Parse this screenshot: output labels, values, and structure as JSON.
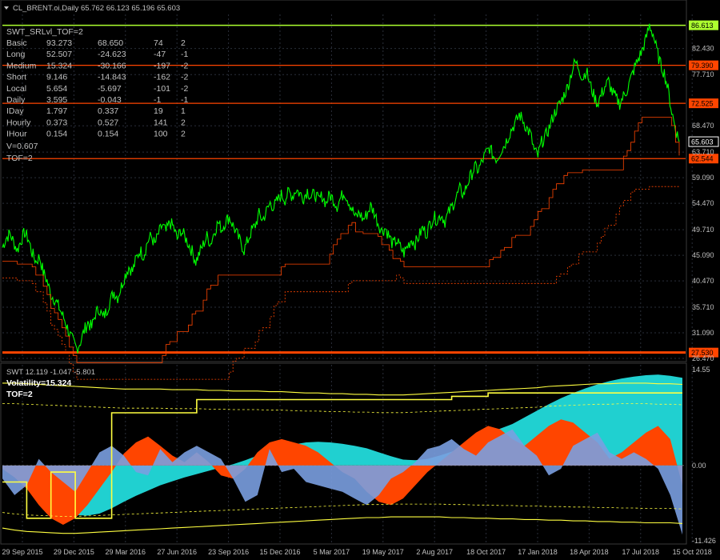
{
  "header": {
    "symbol_line": "CL_BRENT.oi,Daily  65.762 66.123 65.196 65.603"
  },
  "info_panel": {
    "title": "SWT_SRLvl_TOF=2",
    "rows": [
      {
        "name": "Basic",
        "a": "93.273",
        "b": "68.650",
        "c": "74",
        "d": "2"
      },
      {
        "name": "Long",
        "a": "52.507",
        "b": "-24.623",
        "c": "-47",
        "d": "-1"
      },
      {
        "name": "Medium",
        "a": "15.324",
        "b": "-30.166",
        "c": "-197",
        "d": "-2"
      },
      {
        "name": "Short",
        "a": "9.146",
        "b": "-14.843",
        "c": "-162",
        "d": "-2"
      },
      {
        "name": "Local",
        "a": "5.654",
        "b": "-5.697",
        "c": "-101",
        "d": "-2"
      },
      {
        "name": "Daily",
        "a": "3.595",
        "b": "-0.043",
        "c": "-1",
        "d": "-1"
      },
      {
        "name": "IDay",
        "a": "1.797",
        "b": "0.337",
        "c": "19",
        "d": "1"
      },
      {
        "name": "Hourly",
        "a": "0.373",
        "b": "0.527",
        "c": "141",
        "d": "2"
      },
      {
        "name": "IHour",
        "a": "0.154",
        "b": "0.154",
        "c": "100",
        "d": "2"
      }
    ],
    "v_line": "V=0.607",
    "tof_line": "TOF=2"
  },
  "lower_panel": {
    "title": "SWT 12.119 -1.047 -5.801",
    "volatility": "Volatility=15.324",
    "tof": "TOF=2"
  },
  "colors": {
    "background": "#000000",
    "price": "#00ff00",
    "level": "#ff4500",
    "level_thin": "#ff4500",
    "top_level": "#adff2f",
    "grid": "#2a2f3a",
    "text": "#c0c0c0",
    "cyan": "#20d0d0",
    "orange": "#ff4500",
    "blue": "#7a9ee0",
    "yellow": "#ffff40"
  },
  "chart_data": [
    {
      "type": "line",
      "title": "CL_BRENT.oi,Daily",
      "x_tick_labels": [
        "29 Sep 2015",
        "29 Dec 2015",
        "29 Mar 2016",
        "27 Jun 2016",
        "23 Sep 2016",
        "15 Dec 2016",
        "5 Mar 2017",
        "19 May 2017",
        "2 Aug 2017",
        "18 Oct 2017",
        "17 Jan 2018",
        "18 Apr 2018",
        "17 Jul 2018",
        "15 Oct 2018"
      ],
      "y_tick_labels": [
        "82.430",
        "77.710",
        "68.470",
        "63.710",
        "59.090",
        "54.470",
        "49.710",
        "45.090",
        "40.470",
        "35.710",
        "31.090",
        "26.470"
      ],
      "ylim": [
        26.47,
        88.0
      ],
      "price_labels": [
        {
          "value": 86.613,
          "label": "86.613",
          "color": "#adff2f"
        },
        {
          "value": 79.39,
          "label": "79.390",
          "color": "#ff4500"
        },
        {
          "value": 72.525,
          "label": "72.525",
          "color": "#ff4500"
        },
        {
          "value": 65.603,
          "label": "65.603",
          "color": "#ffffff"
        },
        {
          "value": 62.544,
          "label": "62.544",
          "color": "#ff4500"
        },
        {
          "value": 27.53,
          "label": "27.530",
          "color": "#ff4500"
        }
      ],
      "series": [
        {
          "values": [
            46.5,
            48.2,
            49.0,
            47.5,
            46.0,
            47.8,
            49.2,
            48.0,
            45.5,
            44.0,
            44.8,
            42.0,
            40.5,
            38.0,
            37.2,
            36.0,
            34.5,
            33.0,
            31.0,
            29.5,
            28.2,
            29.5,
            31.5,
            33.0,
            32.0,
            34.5,
            35.5,
            33.8,
            35.0,
            37.0,
            38.5,
            37.5,
            39.5,
            41.5,
            43.0,
            42.2,
            44.5,
            46.0,
            45.0,
            47.5,
            48.6,
            47.0,
            49.0,
            50.5,
            49.3,
            51.0,
            50.2,
            48.0,
            49.6,
            48.5,
            47.2,
            45.8,
            44.0,
            45.5,
            47.0,
            48.5,
            47.2,
            49.4,
            51.0,
            49.8,
            51.2,
            52.0,
            50.5,
            49.0,
            47.5,
            46.0,
            47.8,
            49.5,
            50.5,
            52.5,
            51.5,
            53.0,
            54.5,
            53.8,
            55.0,
            56.0,
            55.2,
            56.5,
            55.8,
            57.0,
            56.2,
            55.5,
            56.8,
            55.6,
            56.2,
            55.0,
            55.8,
            54.5,
            56.0,
            55.2,
            54.0,
            55.5,
            56.5,
            55.0,
            53.5,
            51.8,
            52.8,
            51.5,
            52.5,
            54.0,
            52.8,
            51.0,
            49.5,
            50.0,
            48.5,
            47.0,
            47.8,
            46.5,
            45.5,
            46.8,
            48.0,
            47.2,
            48.5,
            50.0,
            49.0,
            50.8,
            52.0,
            51.5,
            52.5,
            51.2,
            52.8,
            54.0,
            55.5,
            57.0,
            56.0,
            58.0,
            59.5,
            61.0,
            60.5,
            62.0,
            63.5,
            64.5,
            63.0,
            62.5,
            64.0,
            65.0,
            66.5,
            68.0,
            69.0,
            70.5,
            69.5,
            68.0,
            67.0,
            64.0,
            63.0,
            65.5,
            66.5,
            68.0,
            70.0,
            71.5,
            72.5,
            74.0,
            75.5,
            78.0,
            80.0,
            79.0,
            77.0,
            78.5,
            76.0,
            74.0,
            72.5,
            74.0,
            75.5,
            76.5,
            74.5,
            73.5,
            72.5,
            73.8,
            75.0,
            77.0,
            79.0,
            80.5,
            82.0,
            84.0,
            86.6,
            85.0,
            82.0,
            79.5,
            78.0,
            75.0,
            71.0,
            68.0,
            65.6
          ]
        }
      ]
    },
    {
      "type": "area",
      "title": "SWT 12.119 -1.047 -5.801",
      "y_tick_labels": [
        "14.55",
        "0.00",
        "-11.426"
      ],
      "ylim": [
        -11.426,
        14.55
      ],
      "series": [
        {
          "name": "cyan",
          "values": [
            -0.5,
            -1.2,
            -2.5,
            -4.0,
            -5.5,
            -6.8,
            -7.5,
            -7.6,
            -7.3,
            -6.5,
            -5.5,
            -4.6,
            -3.8,
            -3.0,
            -2.4,
            -1.8,
            -1.3,
            -0.8,
            -0.3,
            0.2,
            0.8,
            1.5,
            2.2,
            2.8,
            3.2,
            3.5,
            3.6,
            3.5,
            3.3,
            3.0,
            2.6,
            2.0,
            1.4,
            0.9,
            0.8,
            1.0,
            1.5,
            2.1,
            2.8,
            3.8,
            4.8,
            5.6,
            6.3,
            7.3,
            8.3,
            9.3,
            10.2,
            11.0,
            11.7,
            12.3,
            12.8,
            13.2,
            13.5,
            13.7,
            13.8,
            13.6,
            13.3
          ]
        },
        {
          "name": "orange",
          "values": [
            -0.5,
            -1.8,
            -3.5,
            -6.0,
            -8.0,
            -9.0,
            -8.0,
            -6.0,
            -3.5,
            -1.0,
            1.8,
            3.5,
            4.4,
            3.0,
            1.5,
            0.5,
            2.0,
            0.5,
            -1.5,
            -2.0,
            -0.5,
            2.0,
            3.5,
            4.0,
            3.5,
            3.0,
            2.0,
            0.5,
            -1.0,
            -2.0,
            -4.0,
            -5.5,
            -6.0,
            -5.0,
            -3.0,
            -1.0,
            0.5,
            2.0,
            3.5,
            5.0,
            6.0,
            5.5,
            4.0,
            3.0,
            4.5,
            6.0,
            7.0,
            6.5,
            5.0,
            3.5,
            1.0,
            2.0,
            3.5,
            5.0,
            6.0,
            4.0,
            -3.0
          ]
        },
        {
          "name": "blue",
          "values": [
            -2.0,
            -4.5,
            -3.0,
            1.0,
            -1.0,
            -2.5,
            -4.0,
            -1.0,
            2.0,
            3.0,
            1.5,
            -1.0,
            -1.5,
            2.5,
            0.5,
            2.0,
            3.0,
            2.0,
            1.0,
            -2.0,
            -5.5,
            -4.5,
            2.5,
            -1.0,
            -0.5,
            -2.5,
            -3.0,
            -3.5,
            -4.0,
            -5.0,
            -6.0,
            -4.5,
            -2.0,
            -1.0,
            0.5,
            2.5,
            3.0,
            4.0,
            2.5,
            1.5,
            3.5,
            4.5,
            5.5,
            3.0,
            1.5,
            -1.5,
            -0.5,
            3.0,
            4.0,
            5.0,
            2.0,
            1.0,
            2.0,
            1.0,
            -0.5,
            -4.5,
            -10.5
          ]
        },
        {
          "name": "yellow-step",
          "values": [
            -2.5,
            -2.5,
            -8.0,
            -8.0,
            -1.0,
            -1.0,
            -8.0,
            -8.0,
            -8.0,
            8.0,
            8.0,
            8.0,
            8.0,
            8.0,
            8.0,
            8.0,
            10.0,
            10.0,
            10.0,
            10.0,
            10.0,
            10.0,
            10.0,
            10.0,
            10.0,
            10.0,
            10.0,
            10.0,
            10.0,
            10.0,
            10.0,
            10.0,
            10.0,
            10.0,
            10.0,
            10.0,
            10.0,
            10.5,
            10.5,
            10.5,
            11.0,
            11.0,
            11.0,
            11.0,
            11.0,
            11.0,
            11.0,
            11.0,
            11.0,
            11.0,
            11.0,
            11.0,
            11.0,
            11.0,
            11.0,
            11.0,
            11.0
          ]
        },
        {
          "name": "upper-band",
          "values": [
            12.5,
            12.5,
            12.4,
            12.3,
            12.2,
            12.1,
            12.0,
            11.9,
            11.8,
            11.7,
            11.6,
            11.6,
            11.6,
            11.6,
            11.5,
            11.5,
            11.5,
            11.4,
            11.4,
            11.3,
            11.3,
            11.3,
            11.2,
            11.2,
            11.1,
            11.0,
            11.0,
            10.9,
            10.9,
            10.8,
            10.8,
            10.7,
            10.7,
            10.7,
            10.8,
            10.9,
            11.0,
            11.1,
            11.2,
            11.3,
            11.4,
            11.5,
            11.6,
            11.7,
            11.8,
            12.0,
            12.1,
            12.2,
            12.3,
            12.4,
            12.4,
            12.5,
            12.5,
            12.5,
            12.4,
            12.4,
            12.3
          ]
        },
        {
          "name": "lower-band",
          "values": [
            -9.5,
            -9.8,
            -10.0,
            -10.1,
            -10.2,
            -10.3,
            -10.3,
            -10.2,
            -10.1,
            -10.0,
            -9.9,
            -9.8,
            -9.7,
            -9.6,
            -9.5,
            -9.4,
            -9.3,
            -9.2,
            -9.1,
            -9.0,
            -8.9,
            -8.8,
            -8.7,
            -8.6,
            -8.5,
            -8.4,
            -8.3,
            -8.2,
            -8.1,
            -8.0,
            -7.9,
            -7.9,
            -7.8,
            -7.8,
            -7.8,
            -7.8,
            -7.8,
            -7.9,
            -7.9,
            -8.0,
            -8.0,
            -8.1,
            -8.1,
            -8.2,
            -8.2,
            -8.3,
            -8.3,
            -8.4,
            -8.4,
            -8.5,
            -8.5,
            -8.6,
            -8.6,
            -8.7,
            -8.7,
            -8.7,
            -8.8
          ]
        }
      ]
    }
  ]
}
